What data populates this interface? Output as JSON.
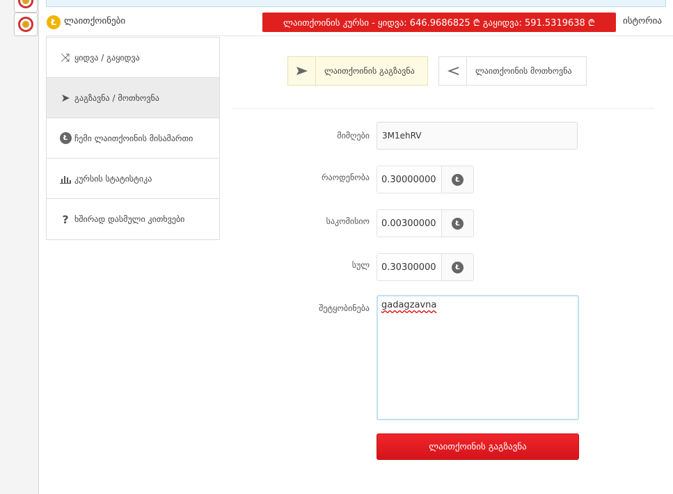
{
  "header": {
    "brand": "ლაითქოინები",
    "rate_text": "ლაითქოინის კურსი - ყიდვა: 646.9686825 ₾  გაყიდვა: 591.5319638 ₾",
    "history": "ისტორია",
    "ltc_badge": "Ł"
  },
  "sidebar": {
    "items": [
      {
        "label": "ყიდვა / გაყიდვა",
        "icon": "shuffle-icon",
        "glyph": "⤨"
      },
      {
        "label": "გაგზავნა / მოთხოვნა",
        "icon": "send-icon",
        "glyph": "➤"
      },
      {
        "label": "ჩემი ლაითქოინის მისამართი",
        "icon": "litecoin-icon",
        "glyph": "Ł"
      },
      {
        "label": "კურსის სტატისტიკა",
        "icon": "bar-chart-icon",
        "glyph": "📊"
      },
      {
        "label": "ხშირად დასმული კითხვები",
        "icon": "question-icon",
        "glyph": "?"
      }
    ]
  },
  "tabs": {
    "send": "ლაითქოინის გაგზავნა",
    "request": "ლაითქოინის მოთხოვნა"
  },
  "form": {
    "recipient_label": "მიმღები",
    "recipient_value": "3M1ehRV",
    "amount_label": "რაოდენობა",
    "amount_value": "0.30000000",
    "fee_label": "საკომისიო",
    "fee_value": "0.00300000",
    "total_label": "სულ",
    "total_value": "0.30300000",
    "message_label": "შეტყობინება",
    "message_value": "gadagzavna",
    "coin_symbol": "Ł",
    "submit_label": "ლაითქოინის გაგზავნა"
  },
  "colors": {
    "accent_red": "#e0201e",
    "active_tab_bg": "#fdfbe3",
    "litecoin_gold": "#f1b400"
  }
}
